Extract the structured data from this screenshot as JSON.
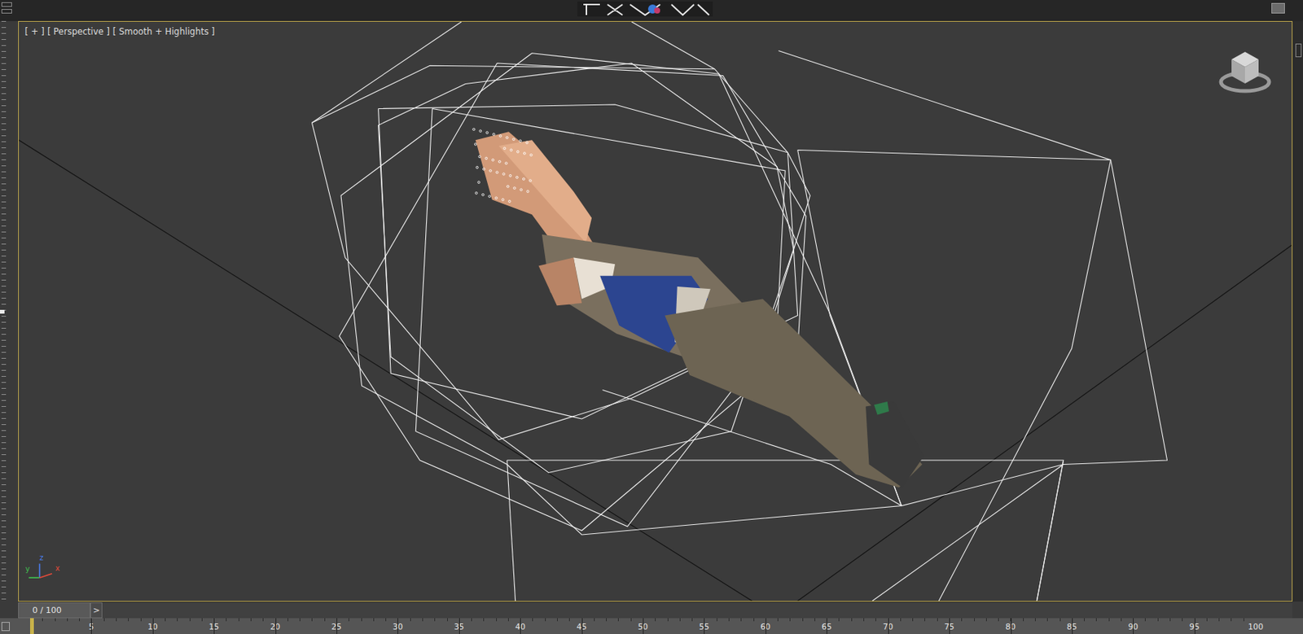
{
  "viewport": {
    "labels": [
      "[ + ]",
      "[ Perspective ]",
      "[ Smooth + Highlights ]"
    ],
    "active": true
  },
  "axis_tripod": {
    "axes": [
      {
        "label": "z",
        "color": "#4a7be8"
      },
      {
        "label": "y",
        "color": "#3fbf4f"
      },
      {
        "label": "x",
        "color": "#e04a3a"
      }
    ]
  },
  "time_slider": {
    "reading": "0 / 100",
    "next_button": ">",
    "level": 0
  },
  "track_bar": {
    "ticks": [
      "5",
      "10",
      "15",
      "20",
      "25",
      "30",
      "35",
      "40",
      "45",
      "50",
      "55",
      "60",
      "65",
      "70",
      "75",
      "80",
      "85",
      "90",
      "95",
      "100"
    ],
    "level": 0
  }
}
